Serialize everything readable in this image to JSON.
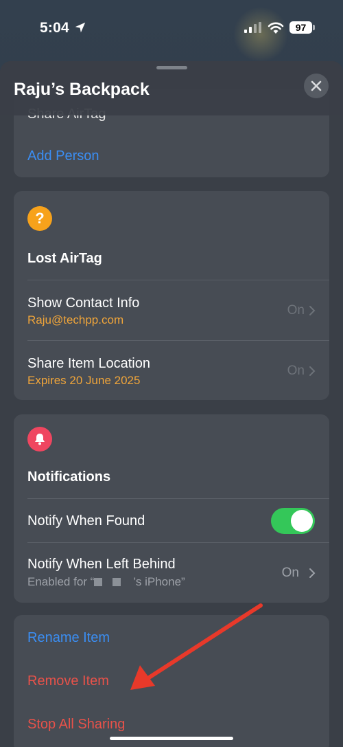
{
  "status": {
    "time": "5:04",
    "battery": "97",
    "icons": [
      "location-arrow-icon",
      "cellular-signal-icon",
      "wifi-icon",
      "battery-icon"
    ]
  },
  "sheet": {
    "title": "Raju’s Backpack",
    "partial_row": "Share AirTag",
    "close_icon": "close-icon"
  },
  "share_card": {
    "add_person": "Add Person"
  },
  "lost_card": {
    "icon": "question-mark-icon",
    "icon_glyph": "?",
    "title": "Lost AirTag",
    "rows": [
      {
        "label": "Show Contact Info",
        "sub": "Raju@techpp.com",
        "value": "On"
      },
      {
        "label": "Share Item Location",
        "sub": "Expires 20 June 2025",
        "value": "On"
      }
    ]
  },
  "notifications_card": {
    "icon": "bell-icon",
    "title": "Notifications",
    "notify_found": {
      "label": "Notify When Found",
      "toggle_on": true
    },
    "notify_left": {
      "label": "Notify When Left Behind",
      "sub_prefix": "Enabled for “",
      "sub_suffix": "’s iPhone”",
      "value": "On"
    }
  },
  "actions_card": {
    "rename": "Rename Item",
    "remove": "Remove Item",
    "stop_sharing": "Stop All Sharing"
  },
  "colors": {
    "link_blue": "#3b8ef3",
    "destructive_red": "#e8524a",
    "accent_orange": "#f0a53a",
    "toggle_green": "#34c759",
    "lost_icon_bg": "#f7a21b",
    "bell_icon_bg": "#ef4660",
    "annotation_arrow": "#e8392a"
  }
}
